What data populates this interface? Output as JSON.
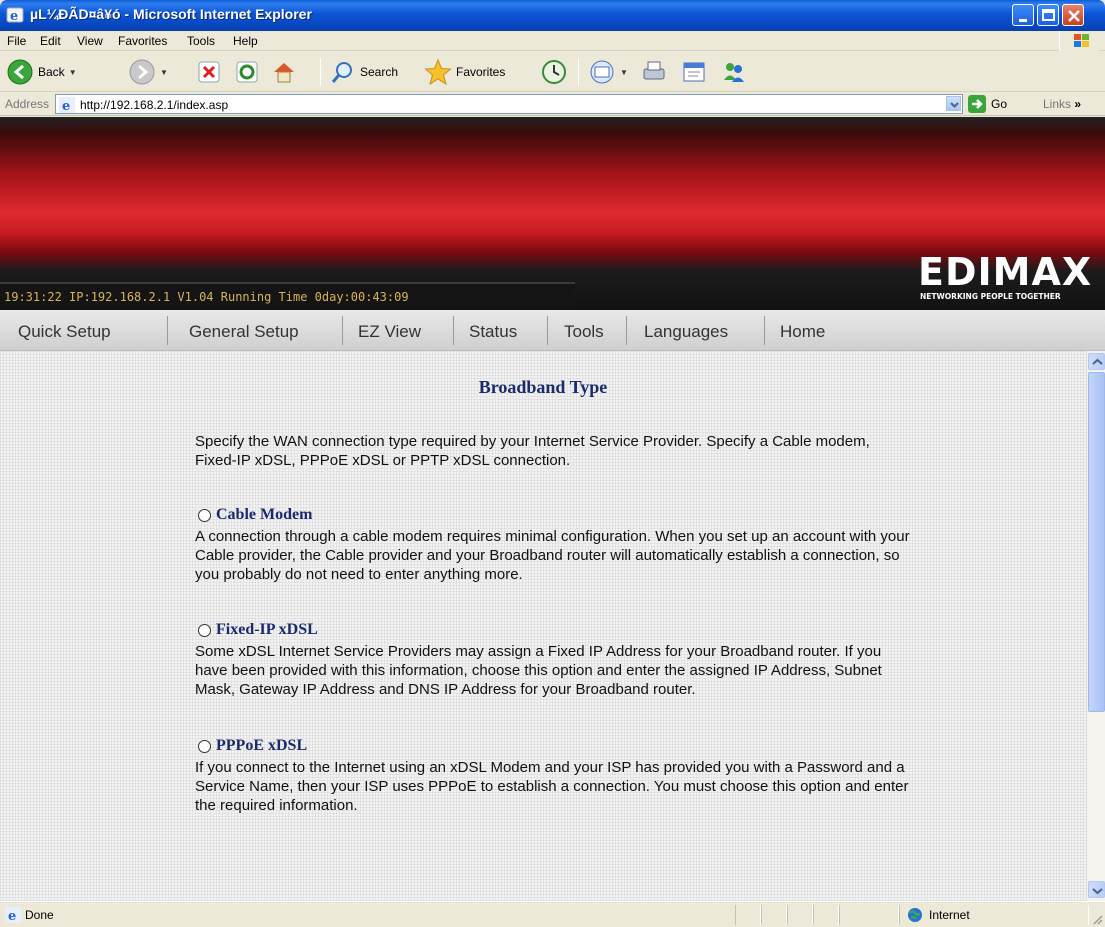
{
  "window": {
    "title": "µL¼ÐÃD¤â¥ó - Microsoft Internet Explorer"
  },
  "menu": {
    "items": [
      "File",
      "Edit",
      "View",
      "Favorites",
      "Tools",
      "Help"
    ]
  },
  "toolbar": {
    "back_label": "Back",
    "search_label": "Search",
    "favorites_label": "Favorites"
  },
  "address_bar": {
    "label": "Address",
    "url": "http://192.168.2.1/index.asp",
    "go_label": "Go",
    "links_label": "Links"
  },
  "router": {
    "status_line": "19:31:22   IP:192.168.2.1   V1.04   Running Time 0day:00:43:09",
    "brand": "EDIMAX",
    "tagline": "NETWORKING PEOPLE TOGETHER",
    "nav": [
      "Quick Setup",
      "General Setup",
      "EZ View",
      "Status",
      "Tools",
      "Languages",
      "Home"
    ]
  },
  "page": {
    "title": "Broadband Type",
    "intro": "Specify the WAN connection type required by your Internet Service Provider. Specify a Cable modem, Fixed-IP xDSL, PPPoE xDSL or PPTP xDSL connection.",
    "options": [
      {
        "label": "Cable Modem",
        "description": "A connection through a cable modem requires minimal configuration. When you set up an account with your Cable provider, the Cable provider and your Broadband router will automatically establish a connection, so you probably do not need to enter anything more."
      },
      {
        "label": "Fixed-IP xDSL",
        "description": "Some xDSL Internet Service Providers may assign a Fixed IP Address for your Broadband router. If you have been provided with this information, choose this option and enter the assigned IP Address, Subnet Mask, Gateway IP Address and DNS IP Address for your Broadband router."
      },
      {
        "label": "PPPoE xDSL",
        "description": "If you connect to the Internet using an xDSL Modem and your ISP has provided you with a Password and a Service Name, then your ISP uses PPPoE to establish a connection. You must choose this option and enter the required information."
      }
    ]
  },
  "statusbar": {
    "text": "Done",
    "zone": "Internet"
  }
}
